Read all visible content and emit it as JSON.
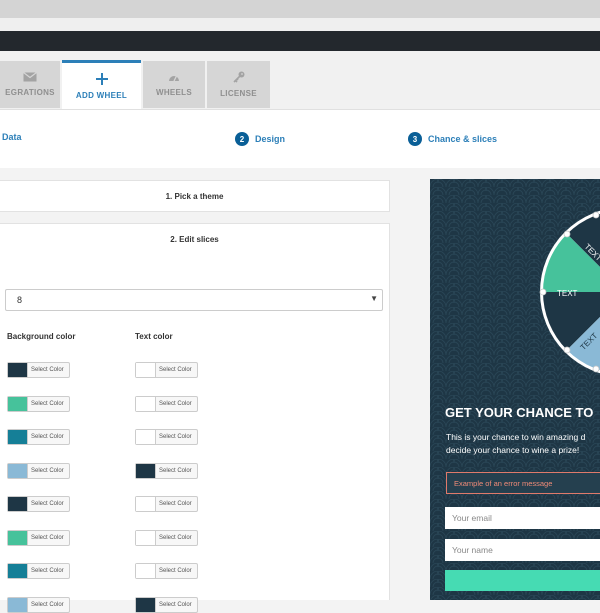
{
  "tabs": [
    {
      "label": "EGRATIONS",
      "icon": "envelope-icon",
      "active": false
    },
    {
      "label": "ADD WHEEL",
      "icon": "plus-icon",
      "active": true
    },
    {
      "label": "WHEELS",
      "icon": "gauge-icon",
      "active": false
    },
    {
      "label": "LICENSE",
      "icon": "key-icon",
      "active": false
    }
  ],
  "steps": [
    {
      "label": "Data"
    },
    {
      "number": "2",
      "label": "Design"
    },
    {
      "number": "3",
      "label": "Chance & slices"
    }
  ],
  "accordion": {
    "pick_theme": "1. Pick a theme",
    "edit_slices": "2. Edit slices"
  },
  "slices_select": {
    "value": "8"
  },
  "columns": {
    "background": "Background color",
    "text": "Text color"
  },
  "picker_label": "Select Color",
  "slice_colors": [
    {
      "bg": "#1e3645",
      "text": "#ffffff"
    },
    {
      "bg": "#46c29b",
      "text": "#ffffff"
    },
    {
      "bg": "#157f97",
      "text": "#ffffff"
    },
    {
      "bg": "#8ab9d6",
      "text": "#1e3645"
    },
    {
      "bg": "#1e3645",
      "text": "#ffffff"
    },
    {
      "bg": "#46c29b",
      "text": "#ffffff"
    },
    {
      "bg": "#157f97",
      "text": "#ffffff"
    },
    {
      "bg": "#8ab9d6",
      "text": "#1e3645"
    }
  ],
  "preview": {
    "wheel_labels": [
      "TEXT",
      "TEXT",
      "TEXT"
    ],
    "title": "GET YOUR CHANCE TO",
    "text": "This is your chance to win amazing d\ndecide your chance to wine a prize!",
    "error": "Example of an error message",
    "email_placeholder": "Your email",
    "name_placeholder": "Your name"
  },
  "colors": {
    "accent": "#2c7fb8",
    "preview_bg": "#1e3645",
    "cta": "#46dbb3",
    "error": "#e07a6b"
  }
}
